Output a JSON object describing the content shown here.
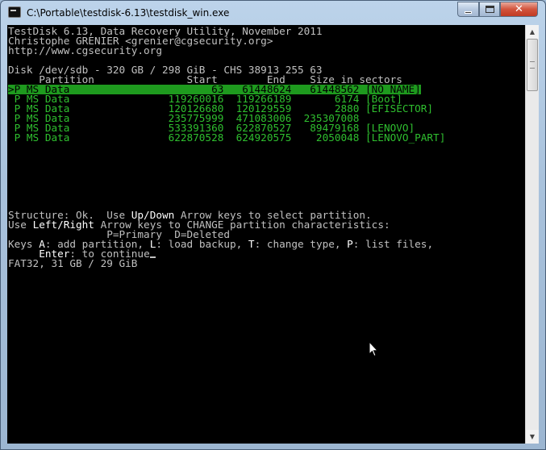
{
  "window": {
    "title": "C:\\Portable\\testdisk-6.13\\testdisk_win.exe",
    "app_icon": "console-icon"
  },
  "caption_buttons": {
    "minimize_icon": "minimize-icon",
    "maximize_icon": "maximize-icon",
    "close_label": "✕"
  },
  "console": {
    "header": [
      "TestDisk 6.13, Data Recovery Utility, November 2011",
      "Christophe GRENIER <grenier@cgsecurity.org>",
      "http://www.cgsecurity.org"
    ],
    "disk_line": "Disk /dev/sdb - 320 GB / 298 GiB - CHS 38913 255 63",
    "columns_line": "     Partition               Start        End    Size in sectors",
    "partitions": [
      {
        "text": ">P MS Data                       63   61448624   61448562 [NO NAME]",
        "selected": true
      },
      {
        "text": " P MS Data                119260016  119266189       6174 [Boot]",
        "selected": false
      },
      {
        "text": " P MS Data                120126680  120129559       2880 [EFISECTOR]",
        "selected": false
      },
      {
        "text": " P MS Data                235775999  471083006  235307008",
        "selected": false
      },
      {
        "text": " P MS Data                533391360  622870527   89479168 [LENOVO]",
        "selected": false
      },
      {
        "text": " P MS Data                622870528  624920575    2050048 [LENOVO_PART]",
        "selected": false
      }
    ],
    "help": {
      "line1_a": "Structure: Ok.  Use ",
      "line1_key": "Up/Down",
      "line1_b": " Arrow keys to select partition.",
      "line2_a": "Use ",
      "line2_key": "Left/Right",
      "line2_b": " Arrow keys to CHANGE partition characteristics:",
      "line3": "                P=Primary  D=Deleted",
      "line4_a": "Keys ",
      "line4_k1": "A",
      "line4_b": ": add partition, ",
      "line4_k2": "L",
      "line4_c": ": load backup, ",
      "line4_k3": "T",
      "line4_d": ": change type, ",
      "line4_k4": "P",
      "line4_e": ": list files,",
      "line5_pad": "     ",
      "line5_key": "Enter",
      "line5_b": ": to continue",
      "line6": "FAT32, 31 GB / 29 GiB"
    }
  },
  "scrollbar": {
    "up_arrow": "▲",
    "down_arrow": "▼"
  }
}
